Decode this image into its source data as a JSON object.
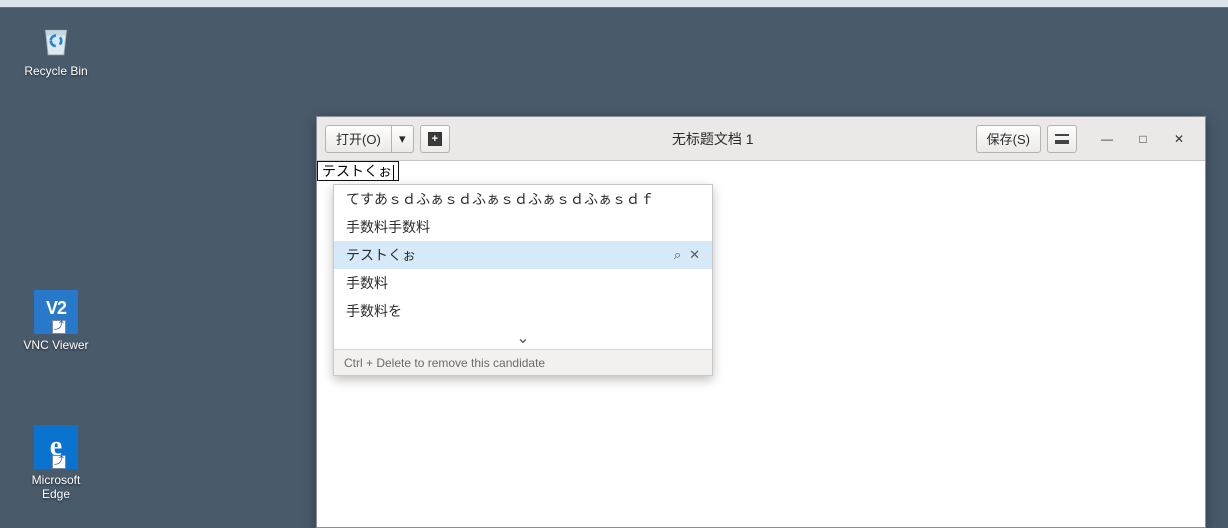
{
  "desktop": {
    "icons": [
      {
        "name": "recycle-bin",
        "label": "Recycle Bin"
      },
      {
        "name": "vnc-viewer",
        "label": "VNC Viewer"
      },
      {
        "name": "microsoft-edge",
        "label": "Microsoft Edge"
      }
    ]
  },
  "window": {
    "open_label": "打开(O)",
    "dropdown_glyph": "▾",
    "new_tab_icon": "plus-doc",
    "title": "无标题文档 1",
    "save_label": "保存(S)",
    "menu_icon": "hamburger",
    "controls": {
      "minimize": "—",
      "maximize": "□",
      "close": "✕"
    }
  },
  "ime": {
    "input_text": "テストくぉ",
    "candidates": [
      {
        "text": "てすあｓｄふぁｓｄふぁｓｄふぁｓｄふぁｓｄｆ",
        "selected": false
      },
      {
        "text": "手数料手数料",
        "selected": false
      },
      {
        "text": "テストくぉ",
        "selected": true,
        "has_search": true,
        "has_close": true
      },
      {
        "text": "手数料",
        "selected": false
      },
      {
        "text": "手数料を",
        "selected": false
      }
    ],
    "expand_glyph": "⌄",
    "search_glyph": "⌕",
    "close_glyph": "✕",
    "hint": "Ctrl + Delete to remove this candidate"
  }
}
